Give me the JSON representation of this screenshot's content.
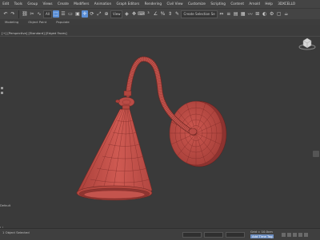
{
  "menubar": {
    "items": [
      "Edit",
      "Tools",
      "Group",
      "Views",
      "Create",
      "Modifiers",
      "Animation",
      "Graph Editors",
      "Rendering",
      "Civil View",
      "Customize",
      "Scripting",
      "Content",
      "Arnold",
      "Help",
      "3DXCELLO"
    ]
  },
  "toolbar": {
    "filter_dropdown": "All",
    "view_dropdown": "View",
    "selection_set_dropdown": "Create Selection Se"
  },
  "subbar": {
    "tabs": [
      "Modeling",
      "Object Paint",
      "Populate"
    ]
  },
  "viewport": {
    "label": "[+] [Perspective] [Standard] [Edged Faces]",
    "left_labels": [
      "Default",
      "[-]"
    ],
    "object_color": "#c4544d",
    "wire_color": "#8a2f2b",
    "background": "#3a3a3a"
  },
  "statusbar": {
    "left_text": "1 Object Selected",
    "grid_readout": "Grid = 10.0cm",
    "add_time_tag": "Add Time Tag"
  }
}
